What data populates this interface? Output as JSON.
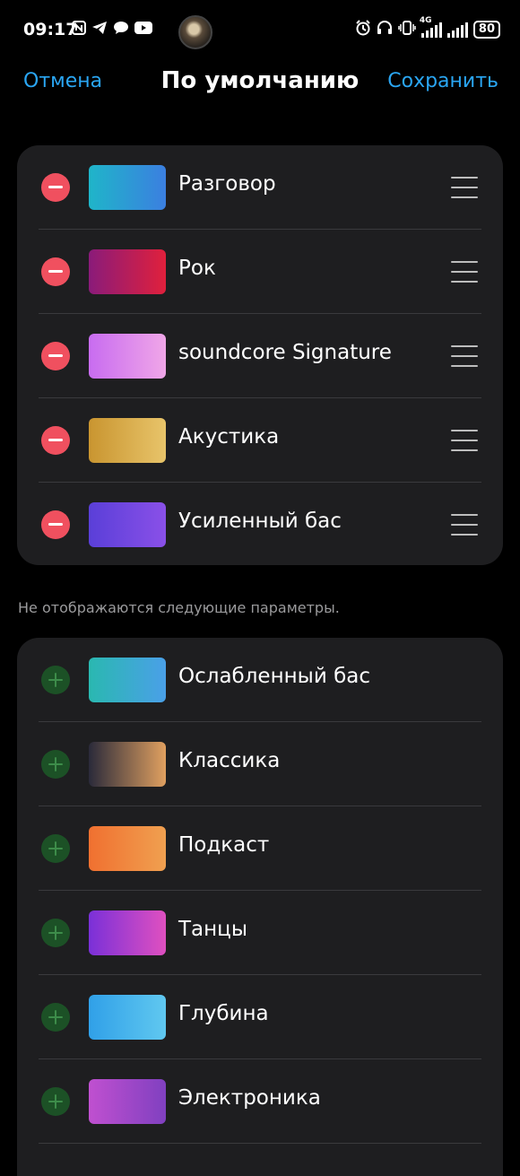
{
  "status_bar": {
    "time": "09:17",
    "left_icons": [
      "nfc-icon",
      "telegram-icon",
      "chat-icon",
      "youtube-icon"
    ],
    "network": "4G",
    "battery": "80"
  },
  "header": {
    "cancel_label": "Отмена",
    "title": "По умолчанию",
    "save_label": "Сохранить"
  },
  "active_presets": [
    {
      "label": "Разговор",
      "thumb_colors": [
        "#1fb5c9",
        "#3b7fe0"
      ]
    },
    {
      "label": "Рок",
      "thumb_colors": [
        "#8a1b7a",
        "#e0203c"
      ]
    },
    {
      "label": "soundcore Signature",
      "thumb_colors": [
        "#c86cf0",
        "#f0a6e8"
      ]
    },
    {
      "label": "Акустика",
      "thumb_colors": [
        "#c99530",
        "#e8c46a"
      ]
    },
    {
      "label": "Усиленный бас",
      "thumb_colors": [
        "#5a3fd8",
        "#8a50e8"
      ]
    }
  ],
  "hidden_note": "Не отображаются следующие параметры.",
  "hidden_presets": [
    {
      "label": "Ослабленный бас",
      "thumb_colors": [
        "#2ab8b0",
        "#4aa0e8"
      ]
    },
    {
      "label": "Классика",
      "thumb_colors": [
        "#2a2a3a",
        "#e0a060"
      ]
    },
    {
      "label": "Подкаст",
      "thumb_colors": [
        "#f07030",
        "#f0a050"
      ]
    },
    {
      "label": "Танцы",
      "thumb_colors": [
        "#7a30d8",
        "#e050c0"
      ]
    },
    {
      "label": "Глубина",
      "thumb_colors": [
        "#30a0e8",
        "#60c8f0"
      ]
    },
    {
      "label": "Электроника",
      "thumb_colors": [
        "#c050d0",
        "#8040c0"
      ]
    }
  ]
}
